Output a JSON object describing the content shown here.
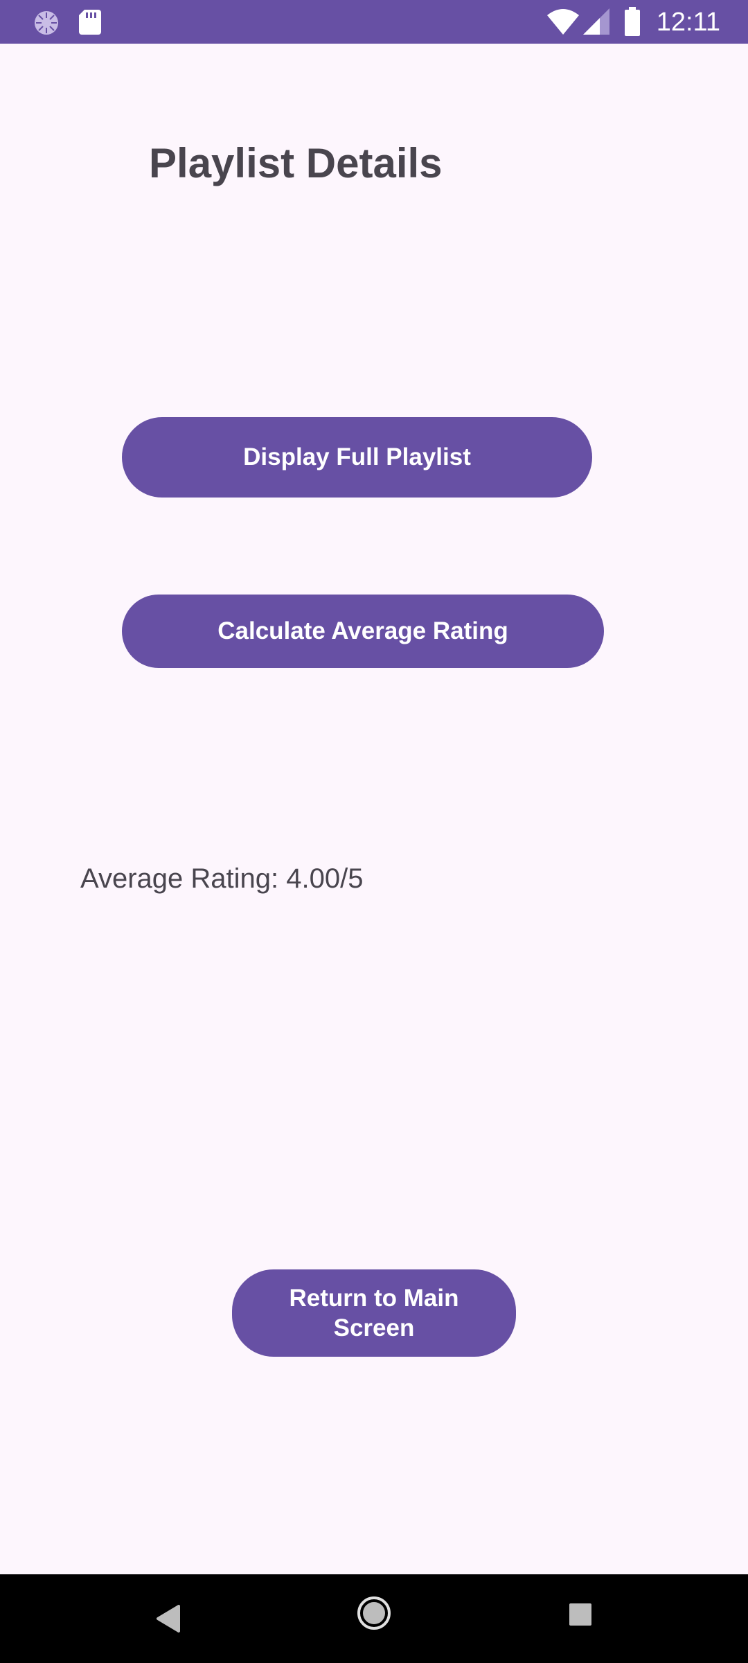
{
  "status_bar": {
    "time": "12:11",
    "icons": [
      "loading-icon",
      "sd-card-icon",
      "wifi-icon",
      "cellular-signal-icon",
      "battery-icon"
    ]
  },
  "page": {
    "title": "Playlist Details"
  },
  "buttons": {
    "display_full_playlist": "Display Full Playlist",
    "calculate_average_rating": "Calculate Average Rating",
    "return_to_main": "Return to Main Screen"
  },
  "average_rating": {
    "text": "Average Rating: 4.00/5"
  },
  "nav_bar": {
    "icons": [
      "back-icon",
      "home-icon",
      "recents-icon"
    ]
  },
  "colors": {
    "primary": "#6750a4",
    "background": "#fdf6fd",
    "text": "#49454e",
    "nav_bar": "#000000"
  }
}
